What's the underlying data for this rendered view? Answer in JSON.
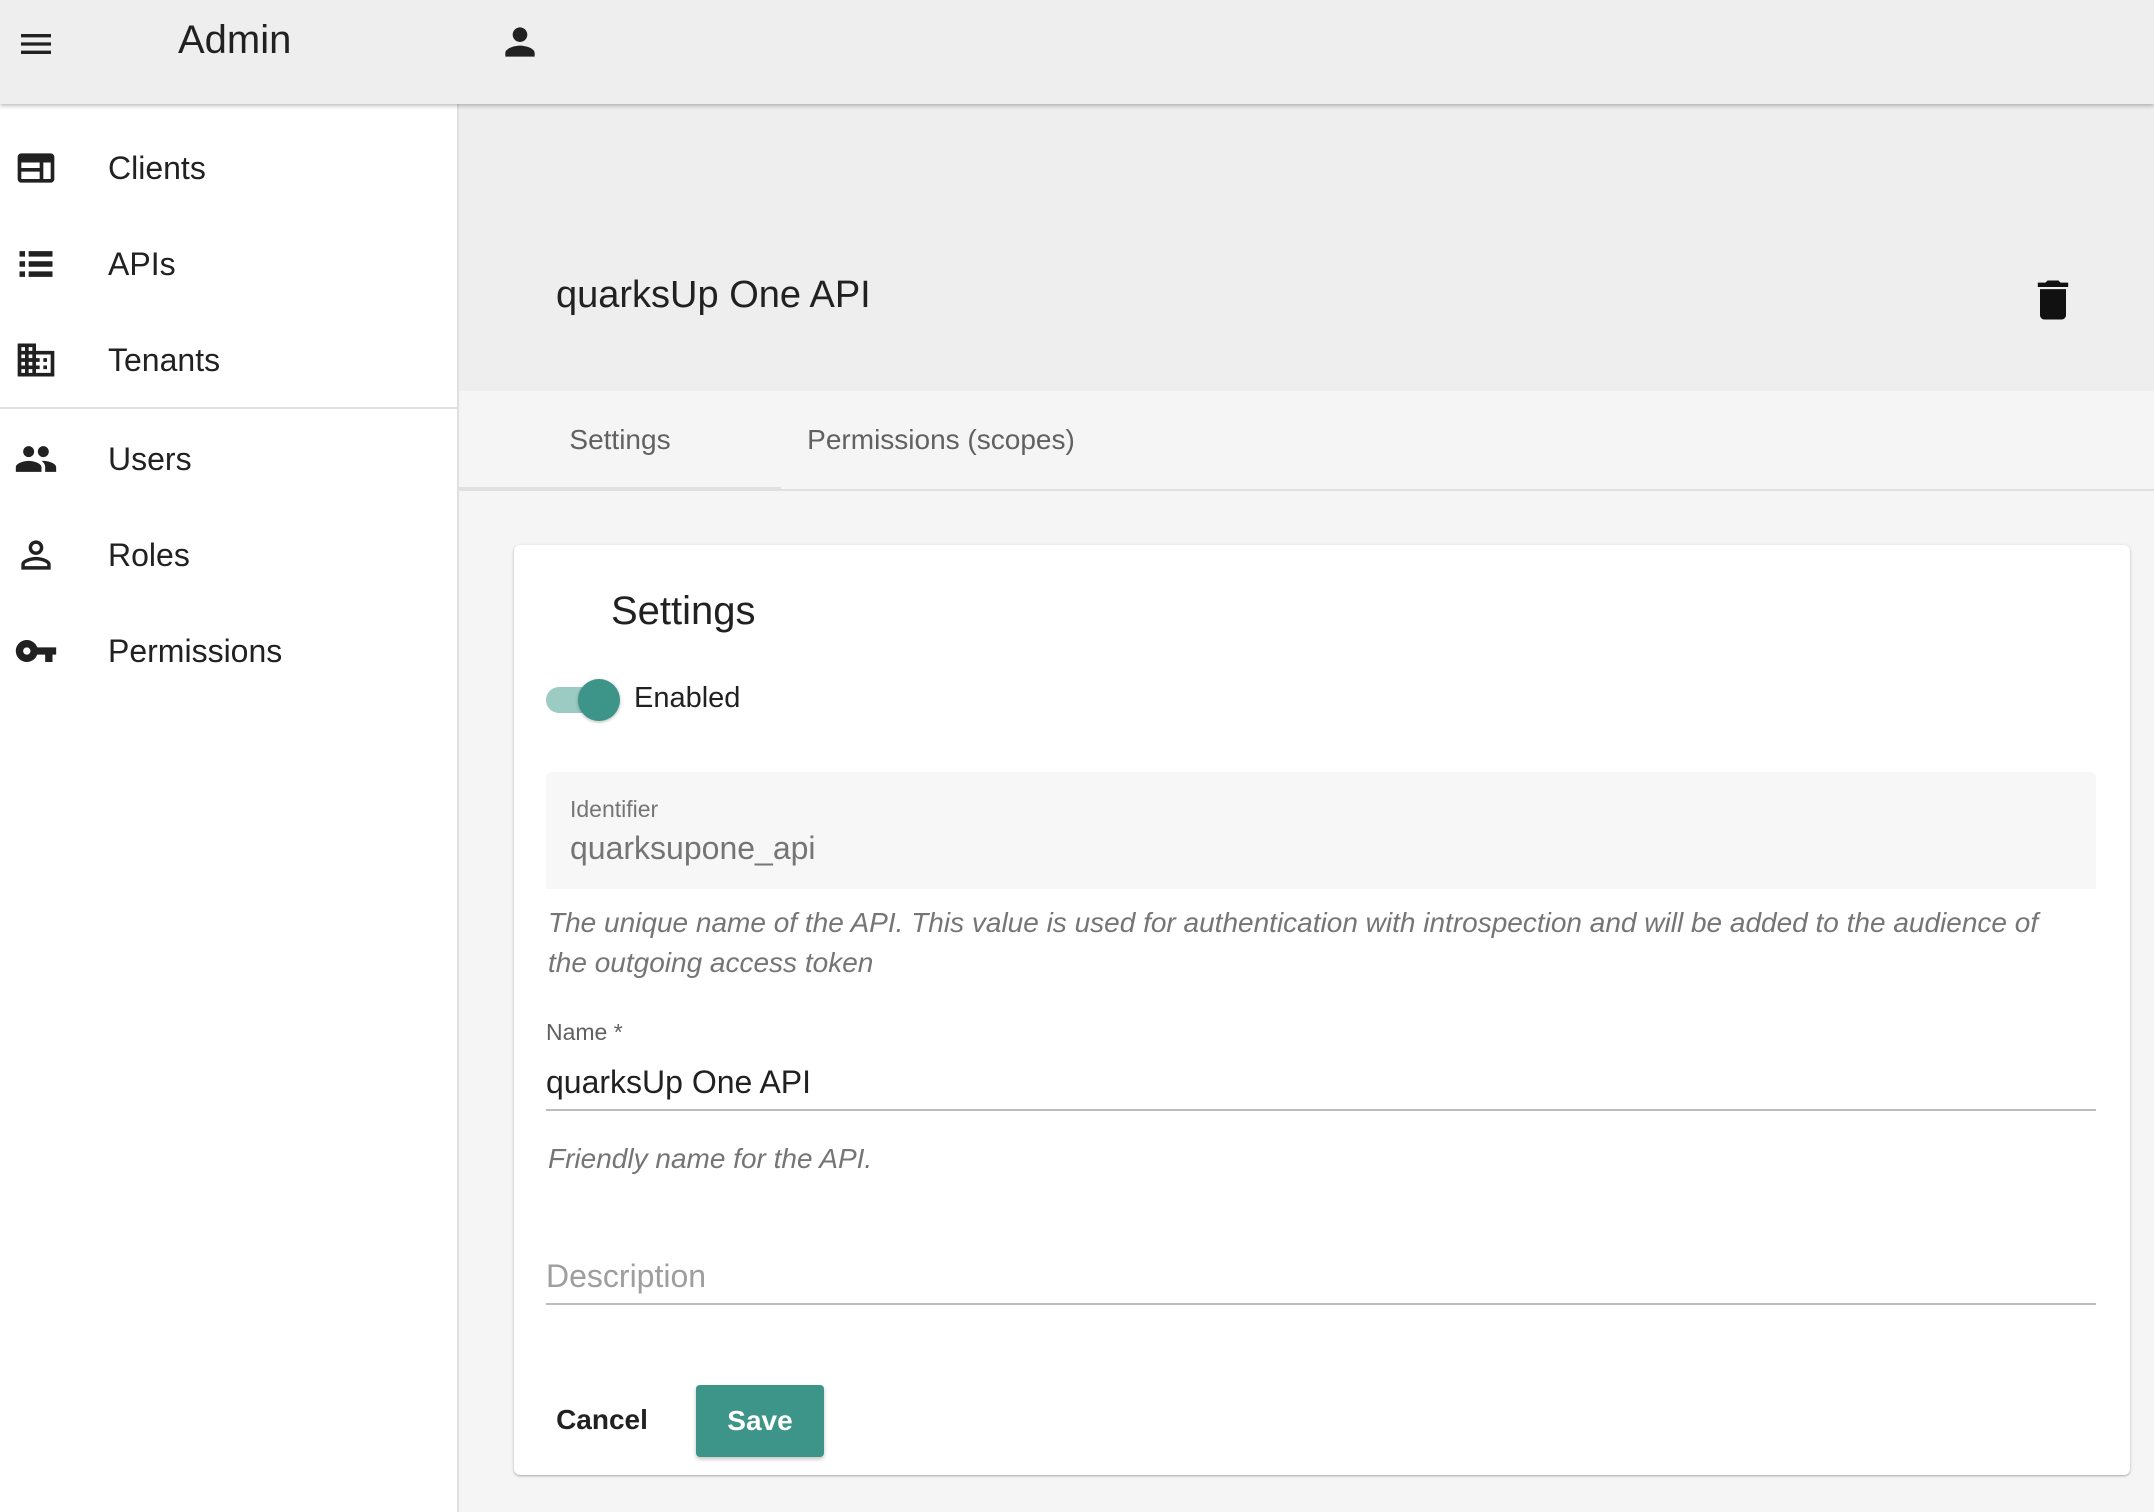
{
  "app": {
    "title": "Admin"
  },
  "icons": {
    "menu": "menu-icon",
    "account": "account-icon",
    "delete": "delete-icon"
  },
  "sidebar": {
    "items": [
      {
        "label": "Clients",
        "icon": "web-window-icon"
      },
      {
        "label": "APIs",
        "icon": "list-icon"
      },
      {
        "label": "Tenants",
        "icon": "building-icon"
      },
      {
        "label": "Users",
        "icon": "people-icon"
      },
      {
        "label": "Roles",
        "icon": "person-outline-icon"
      },
      {
        "label": "Permissions",
        "icon": "key-icon"
      }
    ]
  },
  "page": {
    "title": "quarksUp One API"
  },
  "tabs": [
    {
      "label": "Settings",
      "active": true
    },
    {
      "label": "Permissions (scopes)",
      "active": false
    }
  ],
  "settings": {
    "title": "Settings",
    "enabled_label": "Enabled",
    "enabled": true,
    "identifier": {
      "label": "Identifier",
      "value": "quarksupone_api",
      "helper_line1": "The unique name of the API. This value is used for authentication with introspection and will be added to the audience of",
      "helper_line2": "the outgoing access token"
    },
    "name": {
      "label": "Name *",
      "value": "quarksUp One API",
      "helper": "Friendly name for the API."
    },
    "description": {
      "placeholder": "Description",
      "value": ""
    },
    "cancel_label": "Cancel",
    "save_label": "Save"
  },
  "colors": {
    "accent": "#3d9488",
    "accent_light": "#9ccbc4",
    "appbar": "#eeeeee"
  }
}
